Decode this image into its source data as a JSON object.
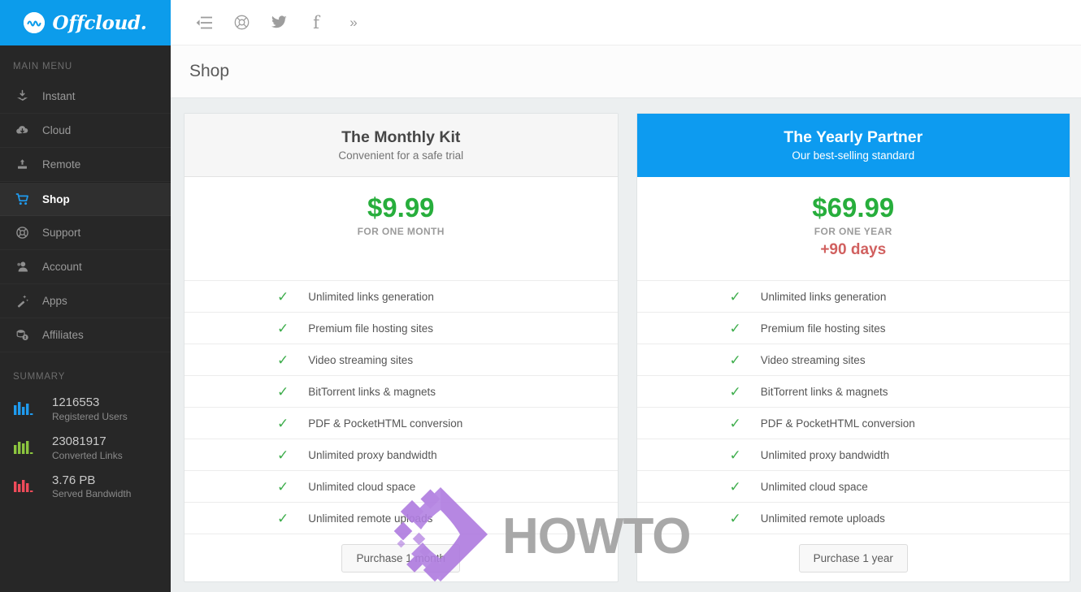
{
  "brand": {
    "name": "Offcloud.",
    "logo_icon": "offcloud-wave-icon",
    "bg_color": "#0c9ceb"
  },
  "sidebar": {
    "menu_heading": "MAIN MENU",
    "items": [
      {
        "label": "Instant",
        "icon": "download-tray-icon",
        "active": false
      },
      {
        "label": "Cloud",
        "icon": "cloud-download-icon",
        "active": false
      },
      {
        "label": "Remote",
        "icon": "upload-server-icon",
        "active": false
      },
      {
        "label": "Shop",
        "icon": "shopping-cart-icon",
        "active": true
      },
      {
        "label": "Support",
        "icon": "lifebuoy-icon",
        "active": false
      },
      {
        "label": "Account",
        "icon": "user-account-icon",
        "active": false
      },
      {
        "label": "Apps",
        "icon": "magic-wand-icon",
        "active": false
      },
      {
        "label": "Affiliates",
        "icon": "money-stack-icon",
        "active": false
      }
    ],
    "summary_heading": "SUMMARY",
    "stats": [
      {
        "value": "1216553",
        "name": "Registered Users",
        "color": "#1f9bef",
        "icon": "bar-chart-icon"
      },
      {
        "value": "23081917",
        "name": "Converted Links",
        "color": "#8cc63f",
        "icon": "bar-chart-icon"
      },
      {
        "value": "3.76 PB",
        "name": "Served Bandwidth",
        "color": "#ef4b5a",
        "icon": "bar-chart-icon"
      }
    ]
  },
  "topbar": {
    "tools": [
      {
        "name": "collapse-sidebar-icon",
        "label": "Collapse sidebar"
      },
      {
        "name": "lifebuoy-icon",
        "label": "Support"
      },
      {
        "name": "twitter-icon",
        "label": "Twitter"
      },
      {
        "name": "facebook-icon",
        "label": "Facebook"
      },
      {
        "name": "chevron-double-right-icon",
        "label": "More"
      }
    ]
  },
  "page": {
    "title": "Shop"
  },
  "plans": [
    {
      "title": "The Monthly Kit",
      "subtitle": "Convenient for a safe trial",
      "featured": false,
      "price": "$9.99",
      "period": "FOR ONE MONTH",
      "bonus": "",
      "features": [
        "Unlimited links generation",
        "Premium file hosting sites",
        "Video streaming sites",
        "BitTorrent links & magnets",
        "PDF & PocketHTML conversion",
        "Unlimited proxy bandwidth",
        "Unlimited cloud space",
        "Unlimited remote uploads"
      ],
      "button": "Purchase 1 month"
    },
    {
      "title": "The Yearly Partner",
      "subtitle": "Our best-selling standard",
      "featured": true,
      "price": "$69.99",
      "period": "FOR ONE YEAR",
      "bonus": "+90 days",
      "features": [
        "Unlimited links generation",
        "Premium file hosting sites",
        "Video streaming sites",
        "BitTorrent links & magnets",
        "PDF & PocketHTML conversion",
        "Unlimited proxy bandwidth",
        "Unlimited cloud space",
        "Unlimited remote uploads"
      ],
      "button": "Purchase 1 year"
    }
  ],
  "watermark": {
    "text": "HOWTO",
    "mark_icon": "howto-arrow-logo",
    "color": "#a8a8a8",
    "mark_color": "#b07de0"
  },
  "colors": {
    "accent_blue": "#0d9bf0",
    "price_green": "#27ae3c",
    "bonus_red": "#d1605f",
    "sidebar_dark": "#272727",
    "page_bg": "#eceff0"
  }
}
